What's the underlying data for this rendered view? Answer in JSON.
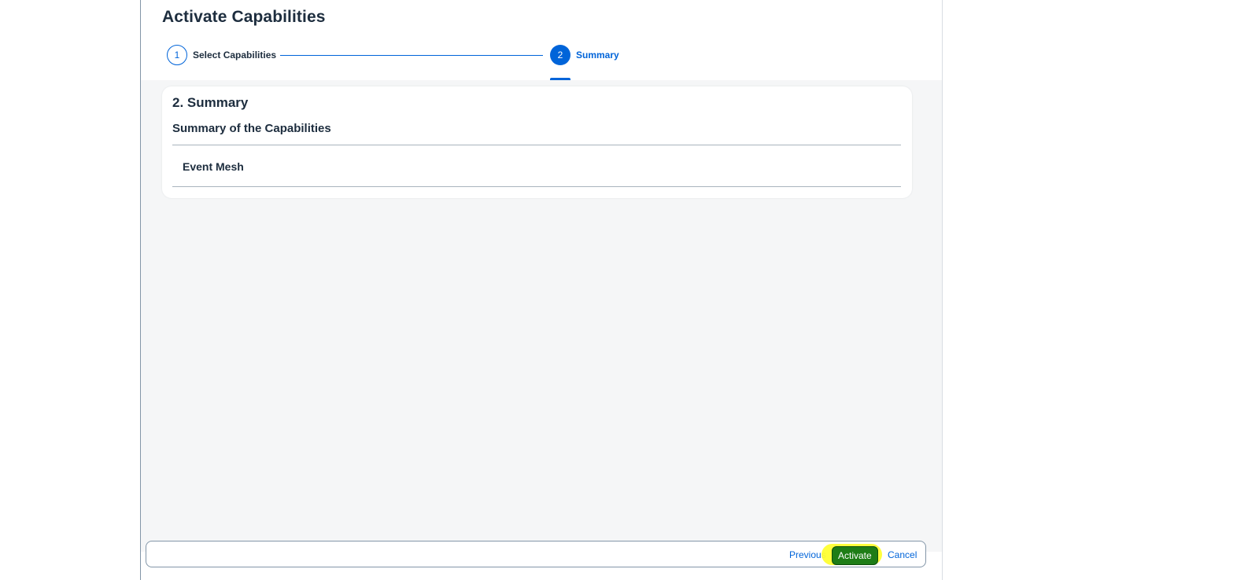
{
  "dialog": {
    "title": "Activate Capabilities"
  },
  "wizard": {
    "steps": [
      {
        "number": "1",
        "label": "Select Capabilities",
        "state": "completed"
      },
      {
        "number": "2",
        "label": "Summary",
        "state": "current"
      }
    ]
  },
  "summary": {
    "heading": "2. Summary",
    "subheading": "Summary of the Capabilities",
    "items": [
      "Event Mesh"
    ]
  },
  "footer": {
    "previous_label": "Previous",
    "activate_label": "Activate",
    "cancel_label": "Cancel"
  },
  "colors": {
    "accent": "#0064d9",
    "emphasized_button": "#1e7d16",
    "highlight": "#ffff33",
    "content_background": "#f5f6f7"
  }
}
